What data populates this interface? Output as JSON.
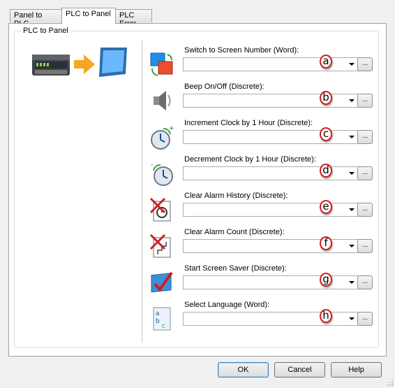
{
  "tabs": [
    {
      "label": "Panel to PLC",
      "active": false
    },
    {
      "label": "PLC to Panel",
      "active": true
    },
    {
      "label": "PLC Error",
      "active": false
    }
  ],
  "group": {
    "label": "PLC to Panel"
  },
  "rows": [
    {
      "label": "Switch to  Screen Number (Word):",
      "value": "",
      "badge": "a",
      "icon": "switch-screen-icon"
    },
    {
      "label": "Beep On/Off (Discrete):",
      "value": "",
      "badge": "b",
      "icon": "speaker-icon"
    },
    {
      "label": "Increment Clock by 1 Hour (Discrete):",
      "value": "",
      "badge": "c",
      "icon": "clock-increment-icon"
    },
    {
      "label": "Decrement Clock by 1 Hour (Discrete):",
      "value": "",
      "badge": "d",
      "icon": "clock-decrement-icon"
    },
    {
      "label": "Clear Alarm History (Discrete):",
      "value": "",
      "badge": "e",
      "icon": "clear-alarm-history-icon"
    },
    {
      "label": "Clear Alarm Count (Discrete):",
      "value": "",
      "badge": "f",
      "icon": "clear-alarm-count-icon"
    },
    {
      "label": "Start Screen Saver (Discrete):",
      "value": "",
      "badge": "g",
      "icon": "screen-saver-icon"
    },
    {
      "label": "Select Language (Word):",
      "value": "",
      "badge": "h",
      "icon": "language-icon"
    }
  ],
  "browse_label": "...",
  "buttons": {
    "ok": "OK",
    "cancel": "Cancel",
    "help": "Help"
  },
  "colors": {
    "badge_border": "#d21c1c",
    "accent_arrow": "#f5a623",
    "monitor": "#3b8fd9"
  }
}
